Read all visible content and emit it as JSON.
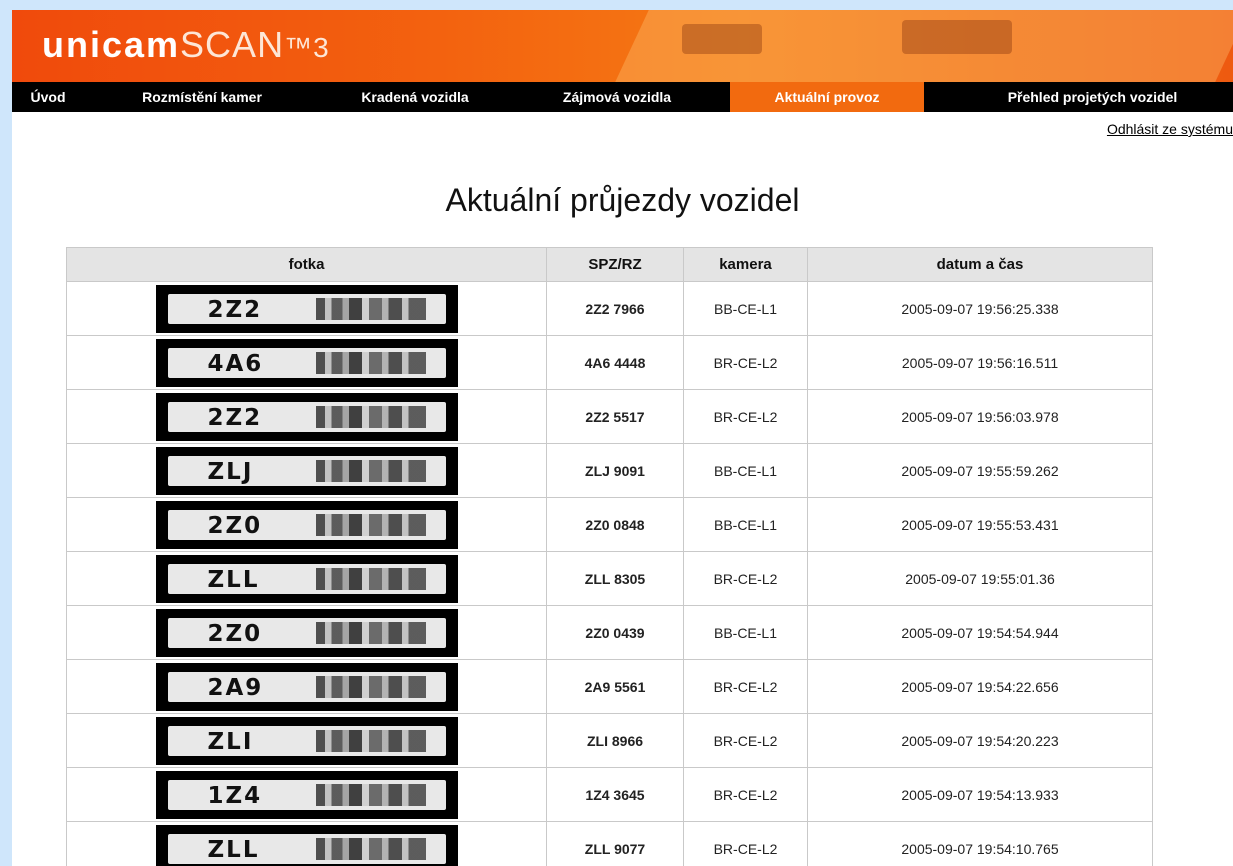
{
  "app": {
    "logo_bold": "unicam",
    "logo_light": "SCAN",
    "logo_tm": "™3"
  },
  "nav": {
    "items": [
      {
        "label": "Úvod",
        "active": false
      },
      {
        "label": "Rozmístění kamer",
        "active": false
      },
      {
        "label": "Kradená vozidla",
        "active": false
      },
      {
        "label": "Zájmová vozidla",
        "active": false
      },
      {
        "label": "Aktuální provoz",
        "active": true
      },
      {
        "label": "Přehled projetých vozidel",
        "active": false
      }
    ],
    "logout": "Odhlásit ze systému"
  },
  "page": {
    "title": "Aktuální průjezdy vozidel"
  },
  "table": {
    "headers": [
      "fotka",
      "SPZ/RZ",
      "kamera",
      "datum a čas"
    ],
    "rows": [
      {
        "plate_prefix": "2Z2",
        "spz": "2Z2 7966",
        "camera": "BB-CE-L1",
        "datetime": "2005-09-07 19:56:25.338"
      },
      {
        "plate_prefix": "4A6",
        "spz": "4A6 4448",
        "camera": "BR-CE-L2",
        "datetime": "2005-09-07 19:56:16.511"
      },
      {
        "plate_prefix": "2Z2",
        "spz": "2Z2 5517",
        "camera": "BR-CE-L2",
        "datetime": "2005-09-07 19:56:03.978"
      },
      {
        "plate_prefix": "ZLJ",
        "spz": "ZLJ 9091",
        "camera": "BB-CE-L1",
        "datetime": "2005-09-07 19:55:59.262"
      },
      {
        "plate_prefix": "2Z0",
        "spz": "2Z0 0848",
        "camera": "BB-CE-L1",
        "datetime": "2005-09-07 19:55:53.431"
      },
      {
        "plate_prefix": "ZLL",
        "spz": "ZLL 8305",
        "camera": "BR-CE-L2",
        "datetime": "2005-09-07 19:55:01.36"
      },
      {
        "plate_prefix": "2Z0",
        "spz": "2Z0 0439",
        "camera": "BB-CE-L1",
        "datetime": "2005-09-07 19:54:54.944"
      },
      {
        "plate_prefix": "2A9",
        "spz": "2A9 5561",
        "camera": "BR-CE-L2",
        "datetime": "2005-09-07 19:54:22.656"
      },
      {
        "plate_prefix": "ZLI",
        "spz": "ZLI 8966",
        "camera": "BR-CE-L2",
        "datetime": "2005-09-07 19:54:20.223"
      },
      {
        "plate_prefix": "1Z4",
        "spz": "1Z4 3645",
        "camera": "BR-CE-L2",
        "datetime": "2005-09-07 19:54:13.933"
      },
      {
        "plate_prefix": "ZLL",
        "spz": "ZLL 9077",
        "camera": "BR-CE-L2",
        "datetime": "2005-09-07 19:54:10.765"
      }
    ]
  },
  "colors": {
    "banner": "#f3620f",
    "nav_bg": "#000000",
    "nav_active": "#f26a0f",
    "outer_bg": "#cfe6fb"
  }
}
